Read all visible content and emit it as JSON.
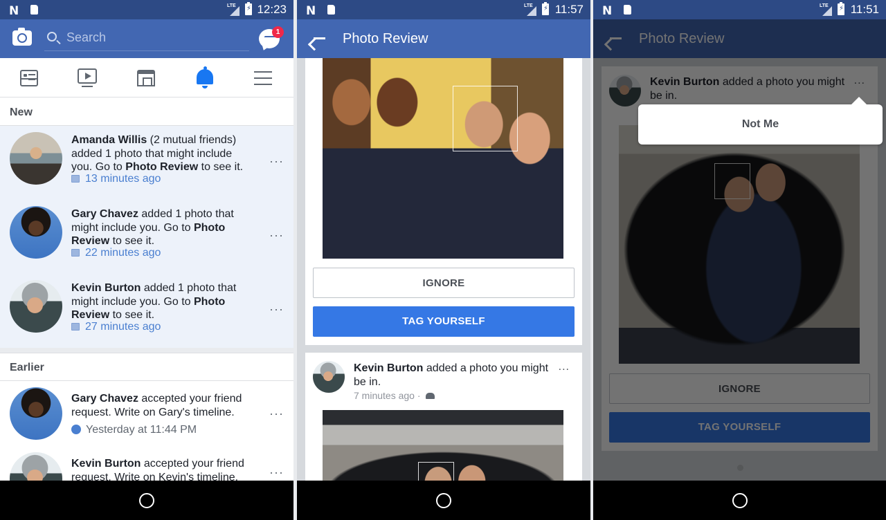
{
  "screens": [
    {
      "statusbar": {
        "time": "12:23",
        "network": "LTE"
      },
      "appbar": {
        "search_placeholder": "Search",
        "messenger_badge": "1"
      },
      "tabs": [
        {
          "name": "news-feed",
          "icon": "news-feed-icon",
          "active": false
        },
        {
          "name": "watch",
          "icon": "video-icon",
          "active": false
        },
        {
          "name": "marketplace",
          "icon": "marketplace-icon",
          "active": false
        },
        {
          "name": "notifications",
          "icon": "bell-icon",
          "active": true
        },
        {
          "name": "menu",
          "icon": "menu-icon",
          "active": false
        }
      ],
      "sections": {
        "new_label": "New",
        "earlier_label": "Earlier"
      },
      "new_notifications": [
        {
          "name": "Amanda Willis",
          "text_before": " (2 mutual friends) added 1 photo that might include you. Go to ",
          "bold2": "Photo Review",
          "text_after": " to see it.",
          "time": "13 minutes ago",
          "icon": "photo-icon"
        },
        {
          "name": "Gary Chavez",
          "text_before": " added 1 photo that might include you. Go to ",
          "bold2": "Photo Review",
          "text_after": " to see it.",
          "time": "22 minutes ago",
          "icon": "photo-icon"
        },
        {
          "name": "Kevin Burton",
          "text_before": " added 1 photo that might include you. Go to ",
          "bold2": "Photo Review",
          "text_after": " to see it.",
          "time": "27 minutes ago",
          "icon": "photo-icon"
        }
      ],
      "earlier_notifications": [
        {
          "name": "Gary Chavez",
          "text": " accepted your friend request. Write on Gary's timeline.",
          "time": "Yesterday at 11:44 PM",
          "icon": "friends-icon"
        },
        {
          "name": "Kevin Burton",
          "text": " accepted your friend request. Write on Kevin's timeline.",
          "time": "",
          "icon": "friends-icon"
        }
      ],
      "more_label": "···"
    },
    {
      "statusbar": {
        "time": "11:57",
        "network": "LTE"
      },
      "appbar": {
        "title": "Photo Review"
      },
      "review_card": {
        "ignore_label": "IGNORE",
        "tag_label": "TAG YOURSELF"
      },
      "post": {
        "name": "Kevin Burton",
        "text": " added a photo you might be in.",
        "time": "7 minutes ago",
        "separator": " · ",
        "audience": "friends",
        "more_label": "..."
      }
    },
    {
      "statusbar": {
        "time": "11:51",
        "network": "LTE"
      },
      "appbar": {
        "title": "Photo Review"
      },
      "post": {
        "name": "Kevin Burton",
        "text": " added a photo you might be in.",
        "more_label": "..."
      },
      "popover": {
        "item": "Not Me"
      },
      "review_card": {
        "ignore_label": "IGNORE",
        "tag_label": "TAG YOURSELF"
      }
    }
  ],
  "colors": {
    "brand_blue": "#4267b2",
    "status_blue": "#2d4a85",
    "accent_button": "#3578e5",
    "unread_bg": "#edf2fa",
    "badge_red": "#f02849",
    "timestamp_blue": "#4a7fd0"
  }
}
